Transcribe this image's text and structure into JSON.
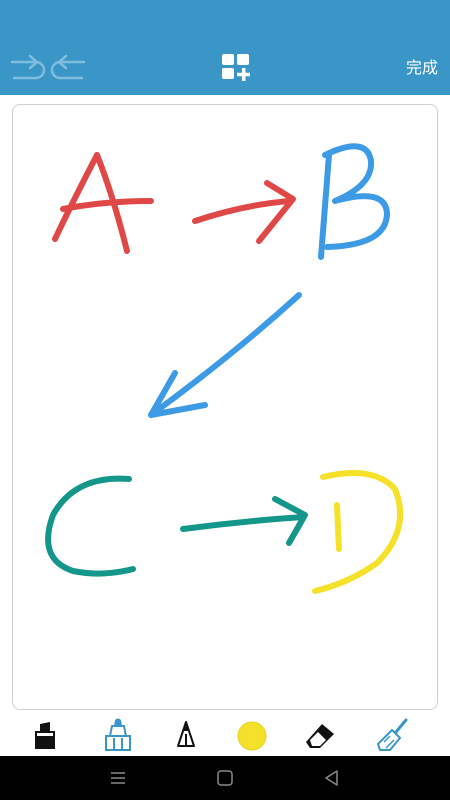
{
  "header": {
    "done_label": "完成",
    "background_color": "#3a96c6",
    "icons": [
      "redo-icon",
      "undo-icon",
      "add-page-icon"
    ]
  },
  "drawing": {
    "strokes": [
      {
        "text": "A",
        "color": "#e04848"
      },
      {
        "text": "→",
        "color": "#e04848"
      },
      {
        "text": "B",
        "color": "#3d9be6"
      },
      {
        "text": "↙",
        "color": "#3d9be6"
      },
      {
        "text": "C",
        "color": "#14968a"
      },
      {
        "text": "→",
        "color": "#14968a"
      },
      {
        "text": "D",
        "color": "#f5e02a"
      }
    ]
  },
  "toolbar": {
    "tools": [
      "marker-icon",
      "highlighter-icon",
      "pencil-icon",
      "color-picker",
      "eraser-icon",
      "clear-icon"
    ],
    "selected_tool": "highlighter-icon",
    "accent_color": "#3a96c6",
    "current_color": "#f5e02a"
  },
  "system_nav": {
    "icons": [
      "menu-icon",
      "home-icon",
      "back-icon"
    ]
  }
}
